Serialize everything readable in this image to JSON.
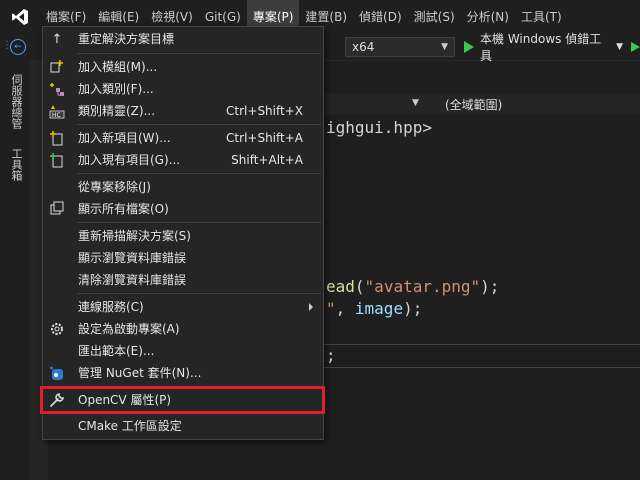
{
  "menubar": {
    "items": [
      "檔案(F)",
      "編輯(E)",
      "檢視(V)",
      "Git(G)",
      "專案(P)",
      "建置(B)",
      "偵錯(D)",
      "測試(S)",
      "分析(N)",
      "工具(T)"
    ],
    "active_index": 4
  },
  "toolbar": {
    "platform": "x64",
    "run_label": "本機 Windows 偵錯工具"
  },
  "side_tabs": [
    "伺服器總管",
    "工具箱"
  ],
  "editor": {
    "scope": "(全域範圍)",
    "code_line1": "ighgui.hpp>",
    "code_line2_fn": "ead",
    "code_line2_str": "\"avatar.png\"",
    "code_line2_end": ");",
    "code_line3_str": "\"",
    "code_line3_sep": ", ",
    "code_line3_var": "image",
    "code_line3_end": ");",
    "code_line4": ";"
  },
  "project_menu": {
    "items": [
      {
        "icon": "up-arrow-icon",
        "label": "重定解決方案目標",
        "shortcut": ""
      },
      {
        "icon": "add-module-icon",
        "label": "加入模組(M)...",
        "shortcut": ""
      },
      {
        "icon": "add-class-icon",
        "label": "加入類別(F)...",
        "shortcut": ""
      },
      {
        "icon": "class-wizard-icon",
        "label": "類別精靈(Z)...",
        "shortcut": "Ctrl+Shift+X"
      },
      {
        "icon": "new-item-icon",
        "label": "加入新項目(W)...",
        "shortcut": "Ctrl+Shift+A"
      },
      {
        "icon": "existing-item-icon",
        "label": "加入現有項目(G)...",
        "shortcut": "Shift+Alt+A"
      },
      {
        "icon": "",
        "label": "從專案移除(J)",
        "shortcut": ""
      },
      {
        "icon": "show-all-files-icon",
        "label": "顯示所有檔案(O)",
        "shortcut": ""
      },
      {
        "icon": "",
        "label": "重新掃描解決方案(S)",
        "shortcut": ""
      },
      {
        "icon": "",
        "label": "顯示瀏覽資料庫錯誤",
        "shortcut": ""
      },
      {
        "icon": "",
        "label": "清除瀏覽資料庫錯誤",
        "shortcut": ""
      },
      {
        "icon": "",
        "label": "連線服務(C)",
        "shortcut": ""
      },
      {
        "icon": "gear-icon",
        "label": "設定為啟動專案(A)",
        "shortcut": ""
      },
      {
        "icon": "",
        "label": "匯出範本(E)...",
        "shortcut": ""
      },
      {
        "icon": "nuget-icon",
        "label": "管理 NuGet 套件(N)...",
        "shortcut": ""
      },
      {
        "icon": "wrench-icon",
        "label": "OpenCV 屬性(P)",
        "shortcut": ""
      },
      {
        "icon": "",
        "label": "CMake 工作區設定",
        "shortcut": ""
      }
    ]
  },
  "colors": {
    "accent_highlight": "#e11f26",
    "run_green": "#3cc84c",
    "logo_purple": "#a277ff"
  }
}
